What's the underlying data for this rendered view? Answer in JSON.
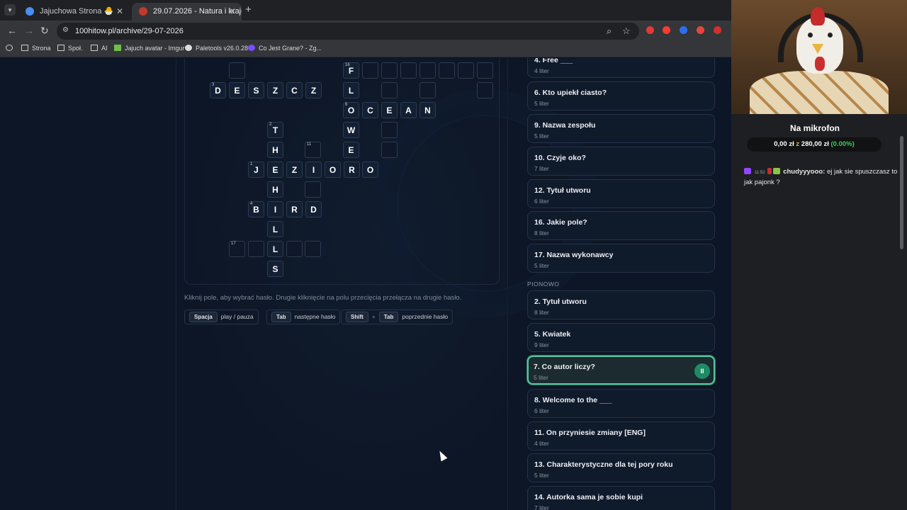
{
  "browser": {
    "tabs": [
      {
        "label": "Jajuchowa Strona 🐣"
      },
      {
        "label": "29.07.2026 - Natura i krajob"
      }
    ],
    "new_tab_symbol": "+",
    "url": "100hitow.pl/archive/29-07-2026",
    "bookmarks": [
      "Strona",
      "Społ.",
      "AI",
      "Jajuch avatar - Imgur",
      "Paletools v26.0.28",
      "Co Jest Grane? - Zg..."
    ]
  },
  "crossword": {
    "cells": [
      {
        "num": "",
        "letter": ""
      },
      {
        "num": "16",
        "letter": "F"
      },
      {
        "num": "",
        "letter": ""
      },
      {
        "num": "",
        "letter": ""
      },
      {
        "num": "",
        "letter": ""
      },
      {
        "num": "",
        "letter": ""
      },
      {
        "num": "",
        "letter": ""
      },
      {
        "num": "",
        "letter": ""
      },
      {
        "num": "",
        "letter": ""
      },
      {
        "num": "3",
        "letter": "D"
      },
      {
        "num": "",
        "letter": "E"
      },
      {
        "num": "",
        "letter": "S"
      },
      {
        "num": "",
        "letter": "Z"
      },
      {
        "num": "",
        "letter": "C"
      },
      {
        "num": "",
        "letter": "Z"
      },
      {
        "num": "",
        "letter": "L"
      },
      {
        "num": "",
        "letter": ""
      },
      {
        "num": "",
        "letter": ""
      },
      {
        "num": "",
        "letter": ""
      },
      {
        "num": "6",
        "letter": "O"
      },
      {
        "num": "",
        "letter": "C"
      },
      {
        "num": "",
        "letter": "E"
      },
      {
        "num": "",
        "letter": "A"
      },
      {
        "num": "",
        "letter": "N"
      },
      {
        "num": "2",
        "letter": "T"
      },
      {
        "num": "",
        "letter": "W"
      },
      {
        "num": "",
        "letter": ""
      },
      {
        "num": "",
        "letter": "H"
      },
      {
        "num": "11",
        "letter": ""
      },
      {
        "num": "",
        "letter": "E"
      },
      {
        "num": "",
        "letter": ""
      },
      {
        "num": "1",
        "letter": "J"
      },
      {
        "num": "",
        "letter": "E"
      },
      {
        "num": "",
        "letter": "Z"
      },
      {
        "num": "",
        "letter": "I"
      },
      {
        "num": "",
        "letter": "O"
      },
      {
        "num": "",
        "letter": "R"
      },
      {
        "num": "",
        "letter": "O"
      },
      {
        "num": "",
        "letter": "H"
      },
      {
        "num": "",
        "letter": ""
      },
      {
        "num": "4",
        "letter": "B"
      },
      {
        "num": "",
        "letter": "I"
      },
      {
        "num": "",
        "letter": "R"
      },
      {
        "num": "",
        "letter": "D"
      },
      {
        "num": "",
        "letter": "L"
      },
      {
        "num": "17",
        "letter": ""
      },
      {
        "num": "",
        "letter": ""
      },
      {
        "num": "",
        "letter": "L"
      },
      {
        "num": "",
        "letter": ""
      },
      {
        "num": "",
        "letter": ""
      },
      {
        "num": "",
        "letter": "S"
      }
    ],
    "hint": "Kliknij pole, aby wybrać hasło. Drugie kliknięcie na polu przecięcia przełącza na drugie hasło.",
    "shortcuts": [
      {
        "keys": [
          "Spacja"
        ],
        "label": "play / pauza"
      },
      {
        "keys": [
          "Tab"
        ],
        "label": "następne hasło"
      },
      {
        "keys": [
          "Shift",
          "Tab"
        ],
        "label": "poprzednie hasło"
      }
    ],
    "plus": "+"
  },
  "clues": {
    "across": [
      {
        "title": "4. Free ___",
        "letters": "4 liter"
      },
      {
        "title": "6. Kto upiekł ciasto?",
        "letters": "5 liter"
      },
      {
        "title": "9. Nazwa zespołu",
        "letters": "5 liter"
      },
      {
        "title": "10. Czyje oko?",
        "letters": "7 liter"
      },
      {
        "title": "12. Tytuł utworu",
        "letters": "6 liter"
      },
      {
        "title": "16. Jakie pole?",
        "letters": "8 liter"
      },
      {
        "title": "17. Nazwa wykonawcy",
        "letters": "5 liter"
      }
    ],
    "down_label": "PIONOWO",
    "down": [
      {
        "title": "2. Tytuł utworu",
        "letters": "8 liter"
      },
      {
        "title": "5. Kwiatek",
        "letters": "9 liter"
      },
      {
        "title": "7. Co autor liczy?",
        "letters": "5 liter"
      },
      {
        "title": "8. Welcome to the ___",
        "letters": "6 liter"
      },
      {
        "title": "11. On przyniesie zmiany [ENG]",
        "letters": "4 liter"
      },
      {
        "title": "13. Charakterystyczne dla tej pory roku",
        "letters": "5 liter"
      },
      {
        "title": "14. Autorka sama je sobie kupi",
        "letters": "7 liter"
      }
    ],
    "active_index": 2,
    "pause_symbol": "II"
  },
  "stream": {
    "mic_title": "Na mikrofon",
    "donation": {
      "current": "0,00 zł",
      "sep": "z",
      "goal": "280,00 zł",
      "percent": "(0.00%)"
    },
    "chat": [
      {
        "time": "11:52",
        "user": "chudyyyooo:",
        "message": "ej jak sie spuszczasz to jak pajonk ?"
      }
    ]
  },
  "colors": {
    "accent": "#55c5a0",
    "pause_button": "#1f8a66",
    "percent": "#39d353"
  }
}
